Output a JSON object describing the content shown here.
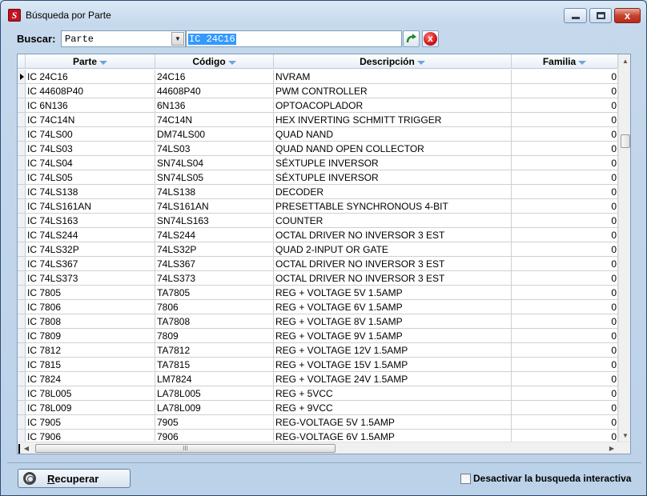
{
  "window": {
    "title": "Búsqueda por Parte",
    "app_icon_letter": "S",
    "close_glyph": "x"
  },
  "search": {
    "label": "Buscar:",
    "field": "Parte",
    "value": "IC 24C16"
  },
  "grid": {
    "columns": [
      "Parte",
      "Código",
      "Descripción",
      "Familia"
    ],
    "rows": [
      {
        "parte": "IC 24C16",
        "codigo": "24C16",
        "descripcion": "NVRAM",
        "familia": "0"
      },
      {
        "parte": "IC 44608P40",
        "codigo": "44608P40",
        "descripcion": "PWM CONTROLLER",
        "familia": "0"
      },
      {
        "parte": "IC 6N136",
        "codigo": "6N136",
        "descripcion": "OPTOACOPLADOR",
        "familia": "0"
      },
      {
        "parte": "IC 74C14N",
        "codigo": "74C14N",
        "descripcion": "HEX INVERTING SCHMITT TRIGGER",
        "familia": "0"
      },
      {
        "parte": "IC 74LS00",
        "codigo": "DM74LS00",
        "descripcion": "QUAD NAND",
        "familia": "0"
      },
      {
        "parte": "IC 74LS03",
        "codigo": "74LS03",
        "descripcion": "QUAD NAND OPEN COLLECTOR",
        "familia": "0"
      },
      {
        "parte": "IC 74LS04",
        "codigo": "SN74LS04",
        "descripcion": "SÉXTUPLE INVERSOR",
        "familia": "0"
      },
      {
        "parte": "IC 74LS05",
        "codigo": "SN74LS05",
        "descripcion": "SÉXTUPLE INVERSOR",
        "familia": "0"
      },
      {
        "parte": "IC 74LS138",
        "codigo": "74LS138",
        "descripcion": "DECODER",
        "familia": "0"
      },
      {
        "parte": "IC 74LS161AN",
        "codigo": "74LS161AN",
        "descripcion": "PRESETTABLE SYNCHRONOUS 4-BIT",
        "familia": "0"
      },
      {
        "parte": "IC 74LS163",
        "codigo": "SN74LS163",
        "descripcion": "COUNTER",
        "familia": "0"
      },
      {
        "parte": "IC 74LS244",
        "codigo": "74LS244",
        "descripcion": "OCTAL DRIVER NO INVERSOR 3 EST",
        "familia": "0"
      },
      {
        "parte": "IC 74LS32P",
        "codigo": "74LS32P",
        "descripcion": "QUAD 2-INPUT OR GATE",
        "familia": "0"
      },
      {
        "parte": "IC 74LS367",
        "codigo": "74LS367",
        "descripcion": "OCTAL DRIVER NO INVERSOR 3 EST",
        "familia": "0"
      },
      {
        "parte": "IC 74LS373",
        "codigo": "74LS373",
        "descripcion": "OCTAL DRIVER NO INVERSOR 3 EST",
        "familia": "0"
      },
      {
        "parte": "IC 7805",
        "codigo": "TA7805",
        "descripcion": "REG + VOLTAGE 5V 1.5AMP",
        "familia": "0"
      },
      {
        "parte": "IC 7806",
        "codigo": "7806",
        "descripcion": "REG + VOLTAGE 6V 1.5AMP",
        "familia": "0"
      },
      {
        "parte": "IC 7808",
        "codigo": "TA7808",
        "descripcion": "REG + VOLTAGE 8V 1.5AMP",
        "familia": "0"
      },
      {
        "parte": "IC 7809",
        "codigo": "7809",
        "descripcion": "REG + VOLTAGE 9V 1.5AMP",
        "familia": "0"
      },
      {
        "parte": "IC 7812",
        "codigo": "TA7812",
        "descripcion": "REG + VOLTAGE 12V 1.5AMP",
        "familia": "0"
      },
      {
        "parte": "IC 7815",
        "codigo": "TA7815",
        "descripcion": "REG + VOLTAGE 15V 1.5AMP",
        "familia": "0"
      },
      {
        "parte": "IC 7824",
        "codigo": "LM7824",
        "descripcion": "REG + VOLTAGE 24V 1.5AMP",
        "familia": "0"
      },
      {
        "parte": "IC 78L005",
        "codigo": "LA78L005",
        "descripcion": "REG + 5VCC",
        "familia": "0"
      },
      {
        "parte": "IC 78L009",
        "codigo": "LA78L009",
        "descripcion": "REG + 9VCC",
        "familia": "0"
      },
      {
        "parte": "IC 7905",
        "codigo": "7905",
        "descripcion": "REG-VOLTAGE 5V 1.5AMP",
        "familia": "0"
      },
      {
        "parte": "IC 7906",
        "codigo": "7906",
        "descripcion": "REG-VOLTAGE 6V 1.5AMP",
        "familia": "0"
      }
    ],
    "hscroll_grip": "III"
  },
  "footer": {
    "recuperar_label": "Recuperar",
    "checkbox_label": "Desactivar la busqueda interactiva",
    "checkbox_checked": false
  }
}
